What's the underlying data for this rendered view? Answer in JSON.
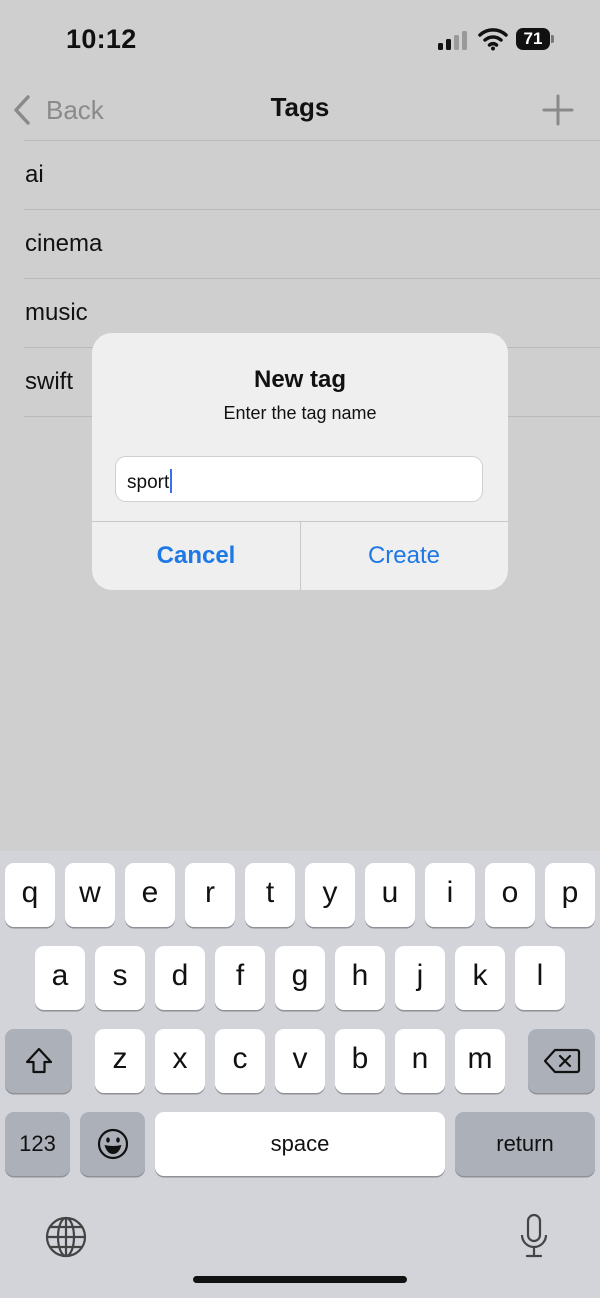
{
  "status_bar": {
    "time": "10:12",
    "battery": "71"
  },
  "nav": {
    "back_label": "Back",
    "title": "Tags"
  },
  "tags": [
    "ai",
    "cinema",
    "music",
    "swift"
  ],
  "alert": {
    "title": "New tag",
    "message": "Enter the tag name",
    "input_value": "sport",
    "cancel_label": "Cancel",
    "create_label": "Create"
  },
  "keyboard": {
    "row1": [
      "q",
      "w",
      "e",
      "r",
      "t",
      "y",
      "u",
      "i",
      "o",
      "p"
    ],
    "row2": [
      "a",
      "s",
      "d",
      "f",
      "g",
      "h",
      "j",
      "k",
      "l"
    ],
    "row3": [
      "z",
      "x",
      "c",
      "v",
      "b",
      "n",
      "m"
    ],
    "numbers_label": "123",
    "space_label": "space",
    "return_label": "return"
  },
  "colors": {
    "accent": "#1e78e6",
    "dim_background": "#cfcfcf",
    "keyboard_bg": "#d2d4da"
  }
}
